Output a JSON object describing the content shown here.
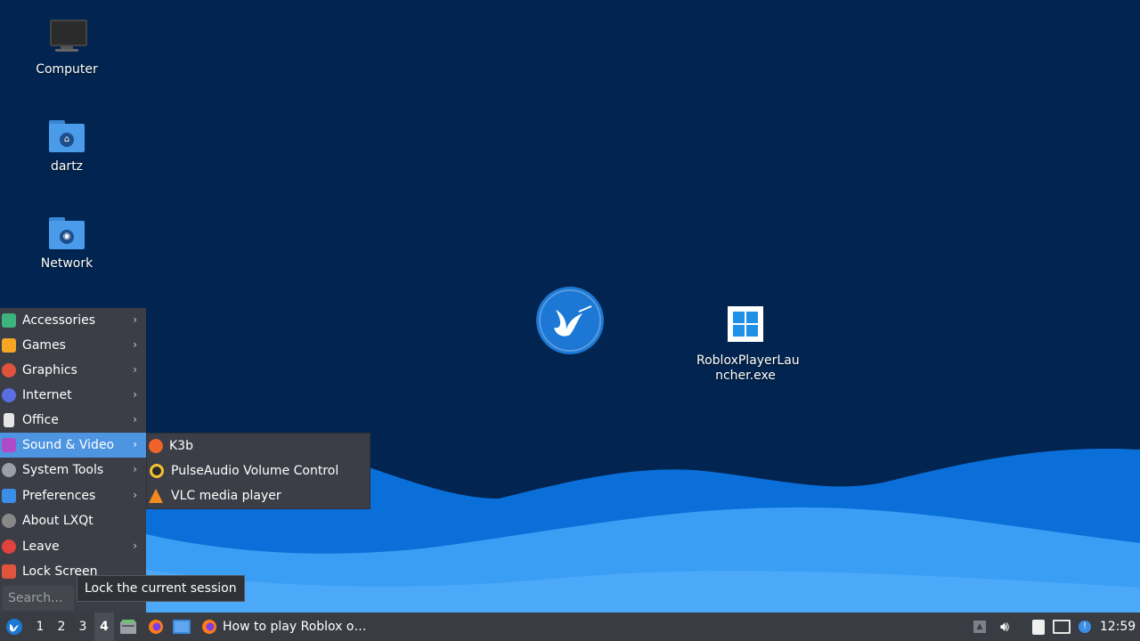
{
  "desktop": {
    "icons": [
      {
        "label": "Computer",
        "icon": "computer-icon"
      },
      {
        "label": "dartz",
        "icon": "home-folder-icon"
      },
      {
        "label": "Network",
        "icon": "network-folder-icon"
      },
      {
        "label": "RobloxPlayerLauncher.exe",
        "label_line1": "RobloxPlayerLau",
        "label_line2": "ncher.exe",
        "icon": "windows-exe-icon"
      }
    ]
  },
  "app_menu": {
    "items": [
      {
        "label": "Accessories",
        "icon": "accessories-icon",
        "color": "#3fb37f",
        "has_submenu": true
      },
      {
        "label": "Games",
        "icon": "games-icon",
        "color": "#f5a623",
        "has_submenu": true
      },
      {
        "label": "Graphics",
        "icon": "graphics-icon",
        "color": "#e0533d",
        "has_submenu": true
      },
      {
        "label": "Internet",
        "icon": "internet-icon",
        "color": "#5b6ee1",
        "has_submenu": true
      },
      {
        "label": "Office",
        "icon": "office-icon",
        "color": "#e6e6e6",
        "has_submenu": true
      },
      {
        "label": "Sound & Video",
        "icon": "sound-video-icon",
        "color": "#b04bc7",
        "has_submenu": true,
        "active": true
      },
      {
        "label": "System Tools",
        "icon": "system-tools-icon",
        "color": "#9aa0a6",
        "has_submenu": true
      },
      {
        "label": "Preferences",
        "icon": "preferences-icon",
        "color": "#3a8ee6",
        "has_submenu": true
      },
      {
        "label": "About LXQt",
        "icon": "info-icon",
        "color": "#888888",
        "has_submenu": false
      },
      {
        "label": "Leave",
        "icon": "power-icon",
        "color": "#e0433d",
        "has_submenu": true
      },
      {
        "label": "Lock Screen",
        "icon": "lock-icon",
        "color": "#e0533d",
        "has_submenu": false
      }
    ],
    "search_placeholder": "Search..."
  },
  "submenu": {
    "items": [
      {
        "label": "K3b",
        "icon": "k3b-icon",
        "color": "#f0632b"
      },
      {
        "label": "PulseAudio Volume Control",
        "icon": "pulseaudio-icon",
        "color": "#f2c230"
      },
      {
        "label": "VLC media player",
        "icon": "vlc-icon",
        "color": "#f58a1f"
      }
    ]
  },
  "tooltip": {
    "text": "Lock the current session"
  },
  "taskbar": {
    "desktops": [
      "1",
      "2",
      "3",
      "4"
    ],
    "current_desktop": "4",
    "window_title": "How to play Roblox o…",
    "clock": "12:59"
  },
  "colors": {
    "background": "#012550",
    "wave_light": "#3a9ef5",
    "wave_dark": "#0a6fd8",
    "accent": "#4d94e1"
  }
}
